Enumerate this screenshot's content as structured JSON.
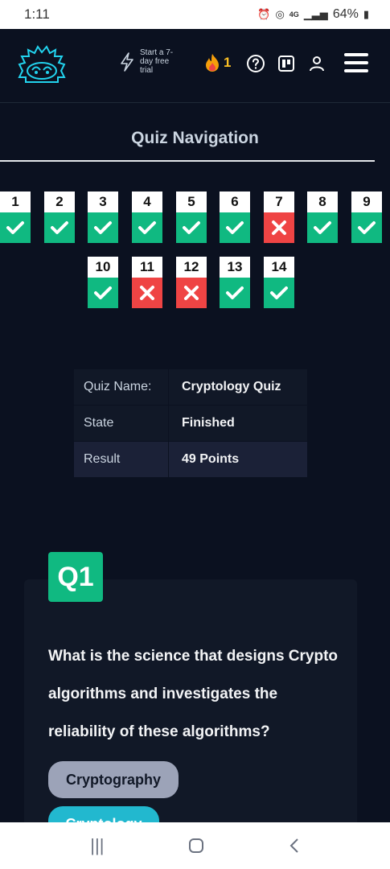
{
  "status_bar": {
    "time": "1:11",
    "network": "4G",
    "battery": "64%"
  },
  "header": {
    "trial_text": "Start a 7-day free trial",
    "streak_count": "1",
    "icons": [
      "lightning-icon",
      "flame-icon",
      "help-icon",
      "board-icon",
      "user-icon",
      "menu-icon"
    ]
  },
  "quiz_navigation": {
    "title": "Quiz Navigation",
    "questions": [
      {
        "number": "1",
        "status": "correct"
      },
      {
        "number": "2",
        "status": "correct"
      },
      {
        "number": "3",
        "status": "correct"
      },
      {
        "number": "4",
        "status": "correct"
      },
      {
        "number": "5",
        "status": "correct"
      },
      {
        "number": "6",
        "status": "correct"
      },
      {
        "number": "7",
        "status": "wrong"
      },
      {
        "number": "8",
        "status": "correct"
      },
      {
        "number": "9",
        "status": "correct"
      },
      {
        "number": "10",
        "status": "correct"
      },
      {
        "number": "11",
        "status": "wrong"
      },
      {
        "number": "12",
        "status": "wrong"
      },
      {
        "number": "13",
        "status": "correct"
      },
      {
        "number": "14",
        "status": "correct"
      }
    ]
  },
  "quiz_info": {
    "rows": [
      {
        "key": "Quiz Name:",
        "value": "Cryptology Quiz"
      },
      {
        "key": "State",
        "value": "Finished"
      },
      {
        "key": "Result",
        "value": "49 Points"
      }
    ]
  },
  "question": {
    "badge": "Q1",
    "text": "What is the science that designs Crypto algorithms and investigates the reliability of these algorithms?",
    "options": [
      "Cryptography",
      "Cryptology"
    ]
  },
  "colors": {
    "background": "#0b1120",
    "correct": "#10b981",
    "wrong": "#ef4444",
    "accent": "#22b8cf"
  }
}
